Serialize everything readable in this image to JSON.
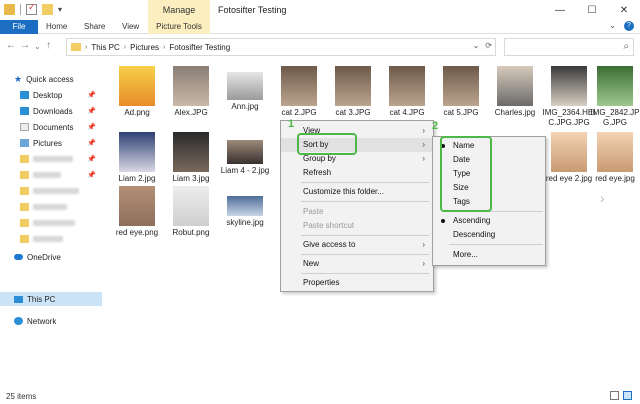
{
  "title_bar": {
    "manage_tab": "Manage",
    "window_title": "Fotosifter Testing",
    "minimize": "—",
    "maximize": "☐",
    "close": "✕"
  },
  "ribbon": {
    "tabs": [
      "File",
      "Home",
      "Share",
      "View",
      "Picture Tools"
    ],
    "expand": "⌄",
    "help": "?"
  },
  "nav": {
    "back": "←",
    "forward": "→",
    "recent": "⌄",
    "up": "↑",
    "breadcrumb": [
      "This PC",
      "Pictures",
      "Fotosifter Testing"
    ],
    "dropdown": "⌄",
    "refresh": "⟳",
    "search_placeholder": ""
  },
  "sidebar": {
    "items": [
      {
        "label": "Quick access",
        "icon": "star-icon"
      },
      {
        "label": "Desktop",
        "icon": "desktop-icon",
        "pinned": true
      },
      {
        "label": "Downloads",
        "icon": "downloads-icon",
        "pinned": true
      },
      {
        "label": "Documents",
        "icon": "documents-icon",
        "pinned": true
      },
      {
        "label": "Pictures",
        "icon": "pictures-icon",
        "pinned": true
      },
      {
        "label": "OneDrive",
        "icon": "onedrive-icon"
      },
      {
        "label": "This PC",
        "icon": "this-pc-icon"
      },
      {
        "label": "Network",
        "icon": "network-icon"
      }
    ]
  },
  "files": [
    {
      "label": "Ad.png"
    },
    {
      "label": "Alex.JPG"
    },
    {
      "label": "Ann.jpg"
    },
    {
      "label": "cat 2.JPG"
    },
    {
      "label": "cat 3.JPG"
    },
    {
      "label": "cat 4.JPG"
    },
    {
      "label": "cat 5.JPG"
    },
    {
      "label": "Charles.jpg"
    },
    {
      "label": "IMG_2364.HEIC.JPG.JPG"
    },
    {
      "label": "IMG_2842.JPG.JPG"
    },
    {
      "label": "Liam 2.jpg"
    },
    {
      "label": "Liam 3.jpg"
    },
    {
      "label": "Liam 4 - 2.jpg"
    },
    {
      "label": "red eye 2.jpg"
    },
    {
      "label": "red eye.jpg"
    },
    {
      "label": "red eye.png"
    },
    {
      "label": "Robut.png"
    },
    {
      "label": "skyline.jpg"
    }
  ],
  "context_menu": {
    "items": [
      "View",
      "Sort by",
      "Group by",
      "Refresh",
      "Customize this folder...",
      "Paste",
      "Paste shortcut",
      "Give access to",
      "New",
      "Properties"
    ]
  },
  "sort_submenu": {
    "items": [
      "Name",
      "Date",
      "Type",
      "Size",
      "Tags",
      "Ascending",
      "Descending",
      "More..."
    ]
  },
  "annotations": {
    "one": "1",
    "two": "2"
  },
  "status": {
    "item_count": "25 items"
  },
  "colors": {
    "accent": "#1b6ec2",
    "annotation": "#4cb847",
    "manage_bg": "#fbeebf"
  }
}
